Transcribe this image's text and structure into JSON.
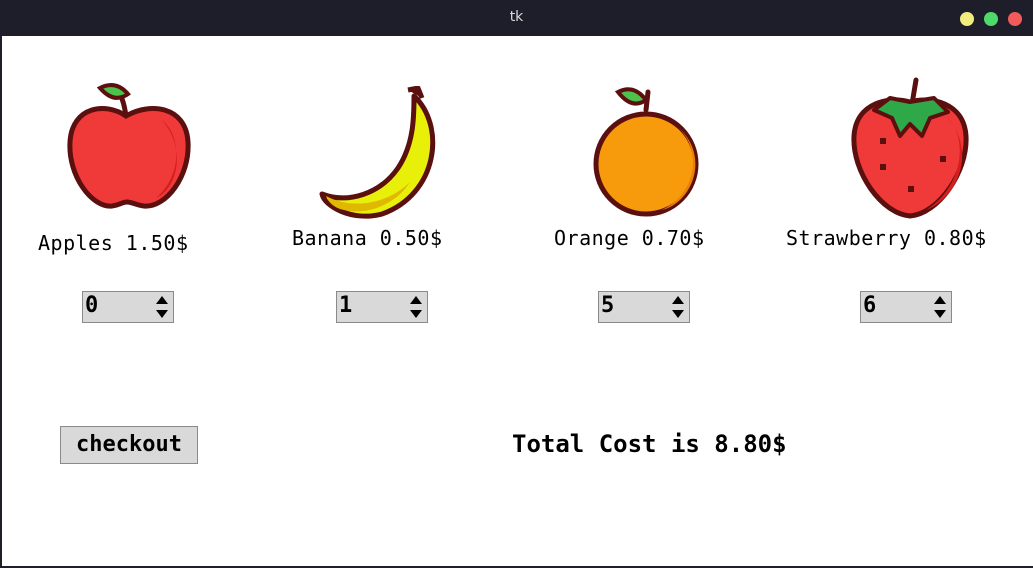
{
  "window": {
    "title": "tk"
  },
  "products": [
    {
      "name": "Apples 1.50$",
      "quantity": "0",
      "icon": "apple-icon"
    },
    {
      "name": "Banana 0.50$",
      "quantity": "1",
      "icon": "banana-icon"
    },
    {
      "name": "Orange 0.70$",
      "quantity": "5",
      "icon": "orange-icon"
    },
    {
      "name": "Strawberry 0.80$",
      "quantity": "6",
      "icon": "strawberry-icon"
    }
  ],
  "checkout": {
    "label": "checkout"
  },
  "total": {
    "text": "Total Cost is 8.80$"
  },
  "colors": {
    "apple": "#f03a3a",
    "banana": "#e8f00a",
    "orange": "#f79a0c",
    "strawberry": "#f03a3a",
    "leaf": "#4cc24c",
    "outline": "#5c0f0f"
  }
}
